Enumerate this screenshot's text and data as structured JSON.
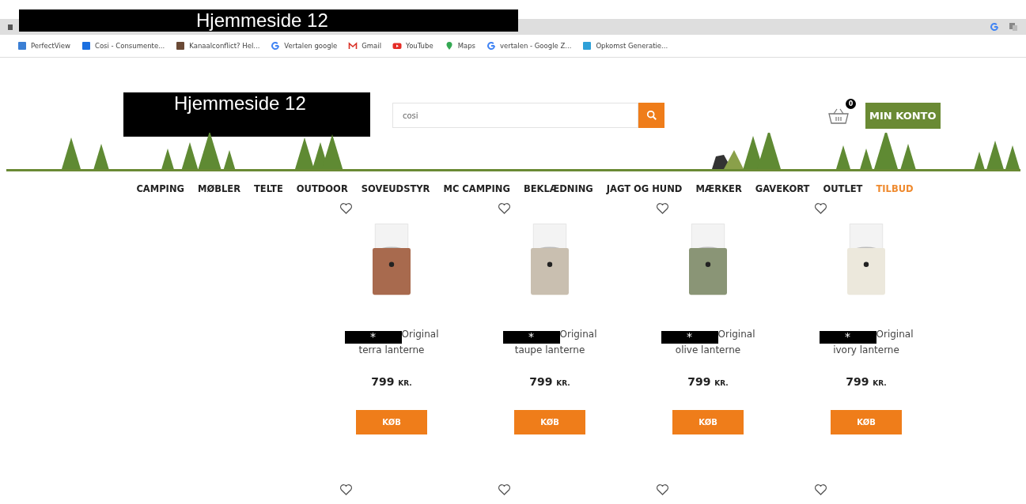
{
  "browser": {
    "title": "Hjemmeside 12"
  },
  "bookmarks": [
    {
      "label": "PerfectView",
      "kind": "square",
      "color": "#3b7fd4"
    },
    {
      "label": "Cosi - Consumente...",
      "kind": "square",
      "color": "#1a6fe0"
    },
    {
      "label": "Kanaalconflict? Hel...",
      "kind": "square",
      "color": "#6b4a36"
    },
    {
      "label": "Vertalen google",
      "kind": "google",
      "color": "#4285f4"
    },
    {
      "label": "Gmail",
      "kind": "mail",
      "color": "#d93025"
    },
    {
      "label": "YouTube",
      "kind": "play",
      "color": "#e52d27"
    },
    {
      "label": "Maps",
      "kind": "pin",
      "color": "#34a853"
    },
    {
      "label": "vertalen - Google Z...",
      "kind": "google",
      "color": "#4285f4"
    },
    {
      "label": "Opkomst Generatie...",
      "kind": "square",
      "color": "#2ea0d8"
    }
  ],
  "header": {
    "logo": "Hjemmeside 12",
    "search": {
      "value": "cosi"
    },
    "cart_count": "0",
    "account_button": "MIN KONTO"
  },
  "nav": [
    {
      "label": "CAMPING",
      "highlight": false
    },
    {
      "label": "MØBLER",
      "highlight": false
    },
    {
      "label": "TELTE",
      "highlight": false
    },
    {
      "label": "OUTDOOR",
      "highlight": false
    },
    {
      "label": "SOVEUDSTYR",
      "highlight": false
    },
    {
      "label": "MC CAMPING",
      "highlight": false
    },
    {
      "label": "BEKLÆDNING",
      "highlight": false
    },
    {
      "label": "JAGT OG HUND",
      "highlight": false
    },
    {
      "label": "MÆRKER",
      "highlight": false
    },
    {
      "label": "GAVEKORT",
      "highlight": false
    },
    {
      "label": "OUTLET",
      "highlight": false
    },
    {
      "label": "TILBUD",
      "highlight": true
    }
  ],
  "products": [
    {
      "kind": "full",
      "mark": "*",
      "title": "Original",
      "subtitle": "terra lanterne",
      "price": "799",
      "currency": "KR.",
      "button": "KØB",
      "color": "#a86a4e"
    },
    {
      "kind": "full",
      "mark": "*",
      "title": "Original",
      "subtitle": "taupe lanterne",
      "price": "799",
      "currency": "KR.",
      "button": "KØB",
      "color": "#c9bfb0"
    },
    {
      "kind": "full",
      "mark": "*",
      "title": "Original",
      "subtitle": "olive lanterne",
      "price": "799",
      "currency": "KR.",
      "button": "KØB",
      "color": "#8a9576"
    },
    {
      "kind": "full",
      "mark": "*",
      "title": "Original",
      "subtitle": "ivory lanterne",
      "price": "799",
      "currency": "KR.",
      "button": "KØB",
      "color": "#ece8dc"
    },
    {
      "kind": "cut"
    },
    {
      "kind": "cut"
    },
    {
      "kind": "cut"
    },
    {
      "kind": "cut"
    }
  ]
}
